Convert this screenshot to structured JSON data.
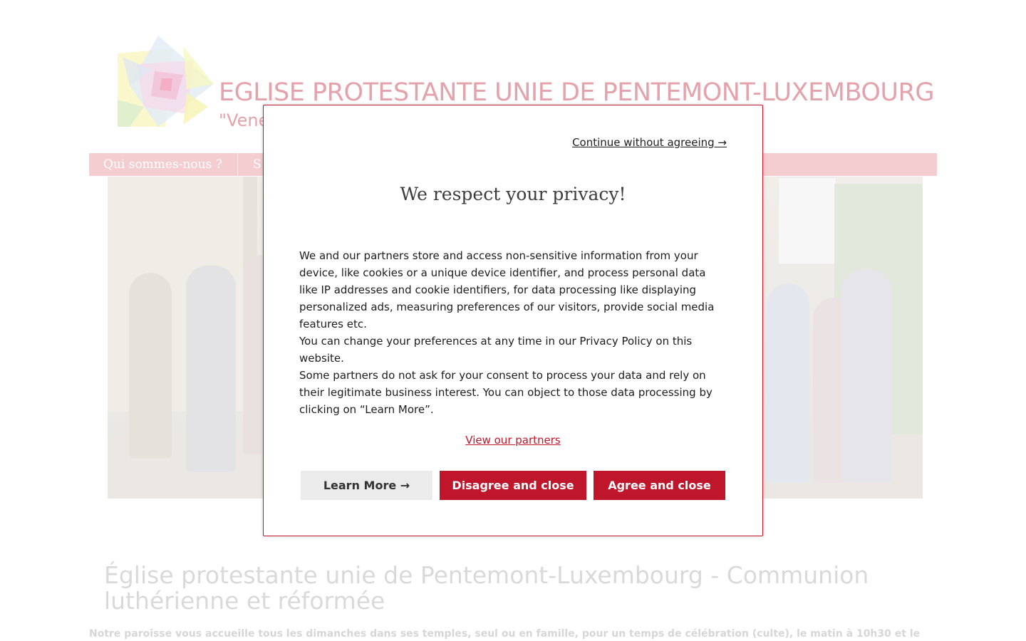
{
  "header": {
    "site_title": "EGLISE PROTESTANTE UNIE DE PENTEMONT-LUXEMBOURG",
    "tagline": "\"Vene"
  },
  "nav": {
    "items": [
      {
        "label": "Qui sommes-nous ?"
      },
      {
        "label": "S"
      }
    ]
  },
  "main": {
    "heading": "Église protestante unie de Pentemont-Luxembourg - Communion luthérienne et réformée",
    "intro": "Notre paroisse vous accueille tous les dimanches dans ses temples, seul ou en famille, pour un temps de célébration (culte), le matin à 10h30 et le"
  },
  "consent": {
    "continue_label": "Continue without agreeing →",
    "title": "We respect your privacy!",
    "paragraphs": [
      "We and our partners store and access non-sensitive information from your device, like cookies or a unique device identifier, and process personal data like IP addresses and cookie identifiers, for data processing like displaying personalized ads, measuring preferences of our visitors, provide social media features etc.",
      "You can change your preferences at any time in our Privacy Policy on this website.",
      "Some partners do not ask for your consent to process your data and rely on their legitimate business interest. You can object to those data processing by clicking on “Learn More”."
    ],
    "partners_link": "View our partners",
    "buttons": {
      "learn_more": "Learn More →",
      "disagree": "Disagree and close",
      "agree": "Agree and close"
    }
  },
  "colors": {
    "accent": "#c0162b",
    "nav_bg": "#f3cdd0",
    "title_pink": "#e4a2ab"
  },
  "icons": {
    "logo": "stained-glass-star-logo"
  }
}
